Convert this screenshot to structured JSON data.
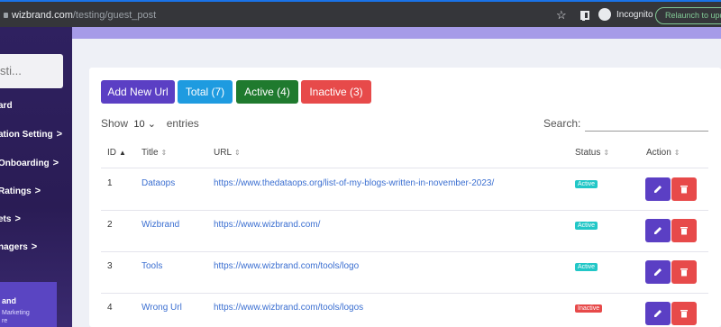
{
  "browser": {
    "url_host": "wizbrand.com",
    "url_path": "/testing/guest_post",
    "incognito_label": "Incognito",
    "relaunch_label": "Relaunch to update"
  },
  "sidebar": {
    "search_placeholder": "sti...",
    "items": [
      {
        "label": "ard",
        "chevron": ""
      },
      {
        "label": "ation Setting",
        "chevron": ">"
      },
      {
        "label": "Onboarding",
        "chevron": ">"
      },
      {
        "label": "Ratings",
        "chevron": ">"
      },
      {
        "label": "ets",
        "chevron": ">"
      },
      {
        "label": "nagers",
        "chevron": ">"
      }
    ],
    "card": {
      "brand": "and",
      "tagline_1": "Marketing",
      "tagline_2": "re"
    }
  },
  "toolbar": {
    "add_label": "Add New Url",
    "total_label": "Total (7)",
    "active_label": "Active (4)",
    "inactive_label": "Inactive (3)"
  },
  "table_controls": {
    "show_label": "Show",
    "entries_value": "10",
    "entries_label": "entries",
    "search_label": "Search:"
  },
  "table": {
    "headers": [
      "ID",
      "Title",
      "URL",
      "Status",
      "Action"
    ],
    "rows": [
      {
        "id": "1",
        "title": "Dataops",
        "url": "https://www.thedataops.org/list-of-my-blogs-written-in-november-2023/",
        "status": "Active"
      },
      {
        "id": "2",
        "title": "Wizbrand",
        "url": "https://www.wizbrand.com/",
        "status": "Active"
      },
      {
        "id": "3",
        "title": "Tools",
        "url": "https://www.wizbrand.com/tools/logo",
        "status": "Active"
      },
      {
        "id": "4",
        "title": "Wrong Url",
        "url": "https://www.wizbrand.com/tools/logos",
        "status": "Inactive"
      }
    ]
  },
  "colors": {
    "primary": "#5b3fc4",
    "info": "#1e9be0",
    "success": "#1f7a2e",
    "danger": "#e74a4a",
    "active_badge": "#22c7c7"
  }
}
